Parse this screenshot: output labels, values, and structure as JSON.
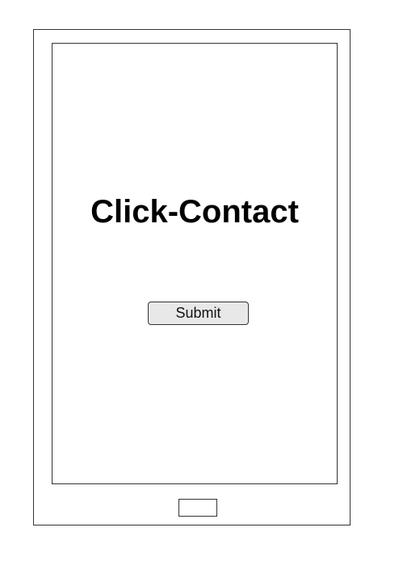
{
  "screen": {
    "title": "Click-Contact",
    "submit_label": "Submit"
  },
  "colors": {
    "border": "#333333",
    "button_background": "#e8e8e8",
    "page_background": "#ffffff"
  }
}
